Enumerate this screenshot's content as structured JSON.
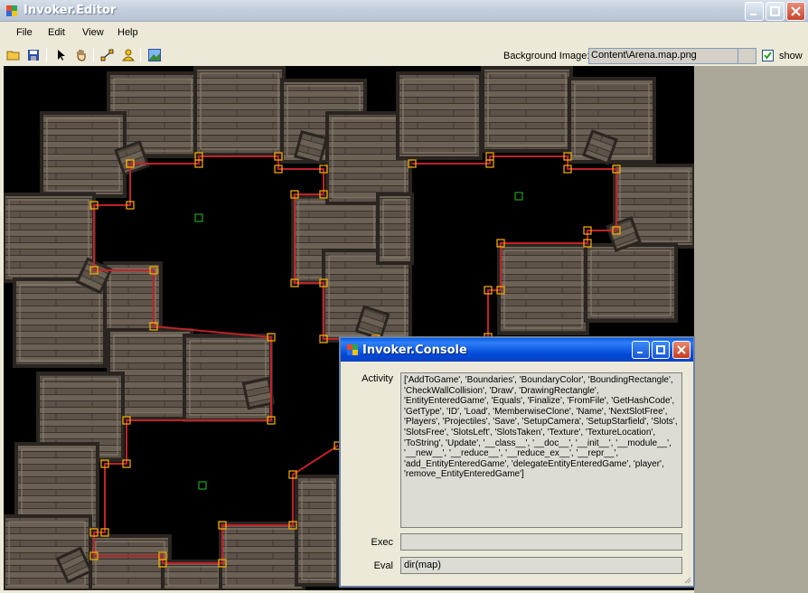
{
  "window": {
    "title": "Invoker.Editor"
  },
  "menu": {
    "items": [
      "File",
      "Edit",
      "View",
      "Help"
    ]
  },
  "toolbar": {
    "icons": [
      "open-folder-icon",
      "save-icon",
      "pointer-icon",
      "hand-icon",
      "nodes-icon",
      "user-icon",
      "image-icon"
    ],
    "background_label": "Background Image:",
    "background_value": "Content\\Arena.map.png",
    "show_label": "show",
    "show_checked": true
  },
  "console": {
    "title": "Invoker.Console",
    "activity_label": "Activity",
    "activity_text": "['AddToGame', 'Boundaries', 'BoundaryColor', 'BoundingRectangle', 'CheckWallCollision', 'Draw', 'DrawingRectangle', 'EntityEnteredGame', 'Equals', 'Finalize', 'FromFile', 'GetHashCode', 'GetType', 'ID', 'Load', 'MemberwiseClone', 'Name', 'NextSlotFree', 'Players', 'Projectiles', 'Save', 'SetupCamera', 'SetupStarfield', 'Slots', 'SlotsFree', 'SlotsLeft', 'SlotsTaken', 'Texture', 'TextureLocation', 'ToString', 'Update', '__class__', '__doc__', '__init__', '__module__', '__new__', '__reduce__', '__reduce_ex__', '__repr__', 'add_EntityEnteredGame', 'delegateEntityEnteredGame', 'player', 'remove_EntityEnteredGame']",
    "exec_label": "Exec",
    "exec_value": "",
    "eval_label": "Eval",
    "eval_value": "dir(map)"
  },
  "colors": {
    "boundary": "#c0222a",
    "handle": "#ffb000",
    "spawn": "#1fa01f",
    "titlebar_active": "#0a5ee8"
  }
}
